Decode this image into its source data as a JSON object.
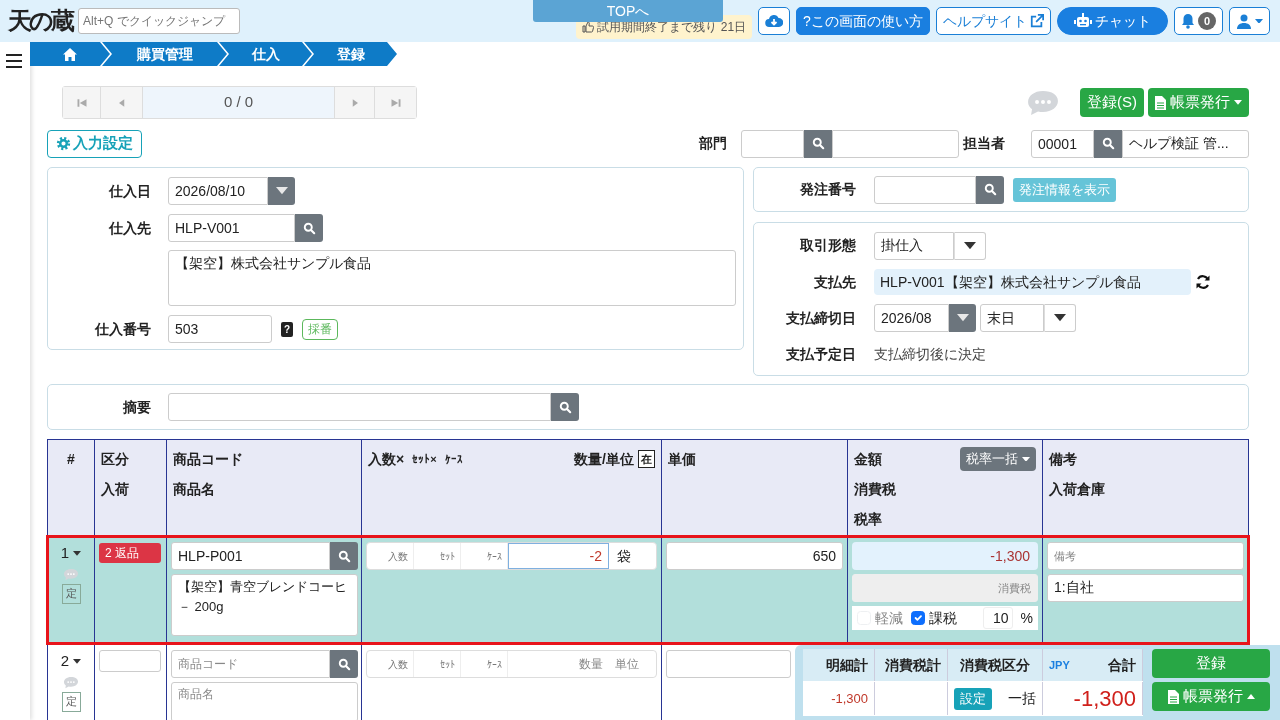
{
  "header": {
    "logo": "天の蔵",
    "quick_jump": {
      "placeholder": "Alt+Q でクイックジャンプ"
    },
    "top_tab": "TOPへ",
    "trial_notice": "試用期間終了まで残り 21日",
    "help_button": "?この画面の使い方",
    "help_site": "ヘルプサイト",
    "chat": "チャット",
    "notification_count": "0"
  },
  "breadcrumbs": [
    "購買管理",
    "仕入",
    "登録"
  ],
  "pager": "0 / 0",
  "actions": {
    "register": "登録(S)",
    "issue": "帳票発行"
  },
  "input_settings": "入力設定",
  "department": {
    "label": "部門"
  },
  "staff": {
    "label": "担当者",
    "code": "00001",
    "name": "ヘルプ検証 管..."
  },
  "purchase": {
    "date_label": "仕入日",
    "date": "2026/08/10",
    "supplier_label": "仕入先",
    "supplier_code": "HLP-V001",
    "supplier_name": "【架空】株式会社サンプル食品",
    "number_label": "仕入番号",
    "number": "503",
    "help_mark": "?",
    "numbering_button": "採番"
  },
  "order": {
    "label": "発注番号",
    "show_button": "発注情報を表示"
  },
  "payment": {
    "trade_type_label": "取引形態",
    "trade_type": "掛仕入",
    "payee_label": "支払先",
    "payee": "HLP-V001【架空】株式会社サンプル食品",
    "cutoff_label": "支払締切日",
    "cutoff_month": "2026/08",
    "cutoff_day": "末日",
    "due_label": "支払予定日",
    "due": "支払締切後に決定"
  },
  "memo": {
    "label": "摘要"
  },
  "table": {
    "columns": [
      {
        "lines": [
          "#"
        ]
      },
      {
        "lines": [
          "区分",
          "入荷"
        ]
      },
      {
        "lines": [
          "商品コード",
          "商品名"
        ]
      },
      {
        "sub": [
          "入数×",
          "ｾｯﾄ×",
          "ｹｰｽ"
        ],
        "right": "数量/単位",
        "tag": "在"
      },
      {
        "lines": [
          "単価"
        ]
      },
      {
        "lines": [
          "金額",
          "消費税",
          "税率"
        ],
        "button": "税率一括"
      },
      {
        "lines": [
          "備考",
          "入荷倉庫"
        ]
      }
    ],
    "rows": [
      {
        "number": "1",
        "selected": true,
        "fixed": "定",
        "category": "2 返品",
        "code": "HLP-P001",
        "name": "【架空】青空ブレンドコーヒ－ 200g",
        "qty_labels": [
          "入数",
          "ｾｯﾄ",
          "ｹｰｽ"
        ],
        "quantity": "-2",
        "unit": "袋",
        "price": "650",
        "amount": "-1,300",
        "tax_placeholder": "消費税",
        "reduced": {
          "label": "軽減",
          "checked": false,
          "disabled": true
        },
        "taxable": {
          "label": "課税",
          "checked": true,
          "disabled": false
        },
        "rate": "10",
        "rate_unit": "%",
        "note_placeholder": "備考",
        "warehouse": "1:自社"
      },
      {
        "number": "2",
        "selected": false,
        "fixed": "定",
        "code_placeholder": "商品コード",
        "name_placeholder": "商品名",
        "qty_labels": [
          "入数",
          "ｾｯﾄ",
          "ｹｰｽ"
        ],
        "quantity_placeholder": "数量",
        "unit_placeholder": "単位"
      }
    ]
  },
  "summary": {
    "headers": [
      "明細計",
      "消費税計",
      "消費税区分",
      "JPY",
      "合計"
    ],
    "subtotal": "-1,300",
    "tax_setting_button": "設定",
    "tax_mode": "一括",
    "total": "-1,300",
    "register": "登録",
    "issue": "帳票発行"
  }
}
